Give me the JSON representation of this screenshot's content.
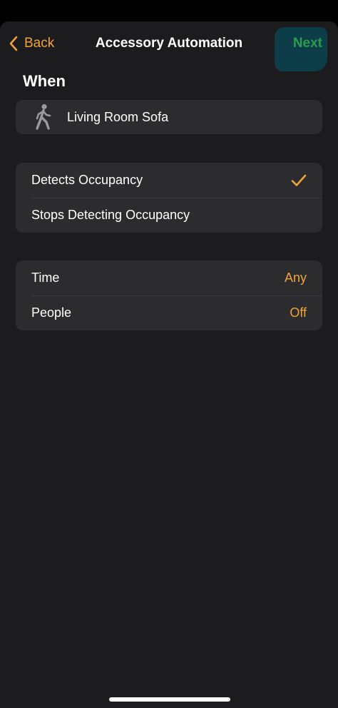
{
  "nav": {
    "back_label": "Back",
    "title": "Accessory Automation",
    "next_label": "Next"
  },
  "when_section": {
    "header": "When",
    "accessory": {
      "name": "Living Room Sofa",
      "icon": "person-walking-icon"
    }
  },
  "trigger_options": [
    {
      "label": "Detects Occupancy",
      "selected": true,
      "icon": "checkmark-icon"
    },
    {
      "label": "Stops Detecting Occupancy",
      "selected": false
    }
  ],
  "conditions": [
    {
      "label": "Time",
      "value": "Any"
    },
    {
      "label": "People",
      "value": "Off"
    }
  ],
  "colors": {
    "accent": "#f1a33b",
    "next": "#2a9c4e",
    "background": "#1c1c1e",
    "cell": "#2c2c2e"
  }
}
